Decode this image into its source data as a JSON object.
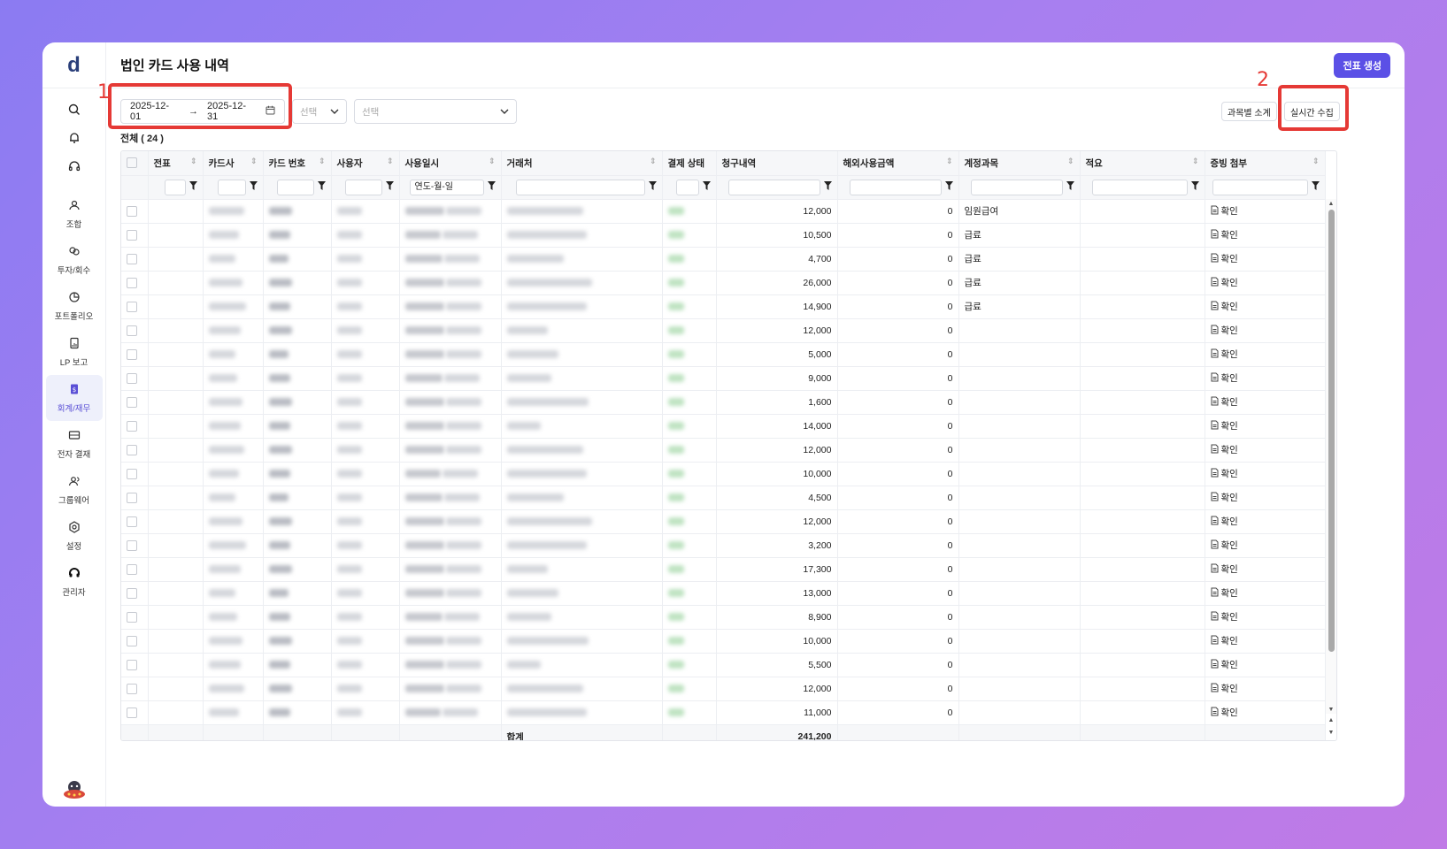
{
  "app": {
    "logo": "d",
    "title": "법인 카드 사용 내역",
    "create_button": "전표 생성"
  },
  "sidebar": {
    "items": [
      {
        "label": "조합",
        "icon": "building-icon"
      },
      {
        "label": "투자/회수",
        "icon": "invest-icon"
      },
      {
        "label": "포트폴리오",
        "icon": "pie-chart-icon"
      },
      {
        "label": "LP 보고",
        "icon": "report-icon"
      },
      {
        "label": "회계/재무",
        "icon": "finance-icon",
        "active": true
      },
      {
        "label": "전자 결재",
        "icon": "mail-icon"
      },
      {
        "label": "그룹웨어",
        "icon": "users-icon"
      },
      {
        "label": "설정",
        "icon": "gear-icon"
      },
      {
        "label": "관리자",
        "icon": "headset-icon"
      }
    ]
  },
  "filters": {
    "date_from": "2025-12-01",
    "date_to": "2025-12-31",
    "select1_placeholder": "선택",
    "select2_placeholder": "선택",
    "subtotal_button": "과목별 소계",
    "realtime_button": "실시간 수집"
  },
  "annotations": {
    "label1": "1",
    "label2": "2"
  },
  "table": {
    "total_label": "전체 ( 24 )",
    "columns": [
      "전표",
      "카드사",
      "카드 번호",
      "사용자",
      "사용일시",
      "거래처",
      "결제 상태",
      "청구내역",
      "해외사용금액",
      "계정과목",
      "적요",
      "증빙 첨부"
    ],
    "date_filter_placeholder": "연도-월-일",
    "proof_label": "확인",
    "rows": [
      {
        "amount": "12,000",
        "foreign": "0",
        "account": "임원급여"
      },
      {
        "amount": "10,500",
        "foreign": "0",
        "account": "급료"
      },
      {
        "amount": "4,700",
        "foreign": "0",
        "account": "급료"
      },
      {
        "amount": "26,000",
        "foreign": "0",
        "account": "급료"
      },
      {
        "amount": "14,900",
        "foreign": "0",
        "account": "급료"
      },
      {
        "amount": "12,000",
        "foreign": "0",
        "account": ""
      },
      {
        "amount": "5,000",
        "foreign": "0",
        "account": ""
      },
      {
        "amount": "9,000",
        "foreign": "0",
        "account": ""
      },
      {
        "amount": "1,600",
        "foreign": "0",
        "account": ""
      },
      {
        "amount": "14,000",
        "foreign": "0",
        "account": ""
      },
      {
        "amount": "12,000",
        "foreign": "0",
        "account": ""
      },
      {
        "amount": "10,000",
        "foreign": "0",
        "account": ""
      },
      {
        "amount": "4,500",
        "foreign": "0",
        "account": ""
      },
      {
        "amount": "12,000",
        "foreign": "0",
        "account": ""
      },
      {
        "amount": "3,200",
        "foreign": "0",
        "account": ""
      },
      {
        "amount": "17,300",
        "foreign": "0",
        "account": ""
      },
      {
        "amount": "13,000",
        "foreign": "0",
        "account": ""
      },
      {
        "amount": "8,900",
        "foreign": "0",
        "account": ""
      },
      {
        "amount": "10,000",
        "foreign": "0",
        "account": ""
      },
      {
        "amount": "5,500",
        "foreign": "0",
        "account": ""
      },
      {
        "amount": "12,000",
        "foreign": "0",
        "account": ""
      },
      {
        "amount": "11,000",
        "foreign": "0",
        "account": ""
      }
    ],
    "footer": {
      "label": "합계",
      "sum": "241,200"
    }
  },
  "colors": {
    "accent": "#5b50e6",
    "highlight": "#e53935"
  }
}
